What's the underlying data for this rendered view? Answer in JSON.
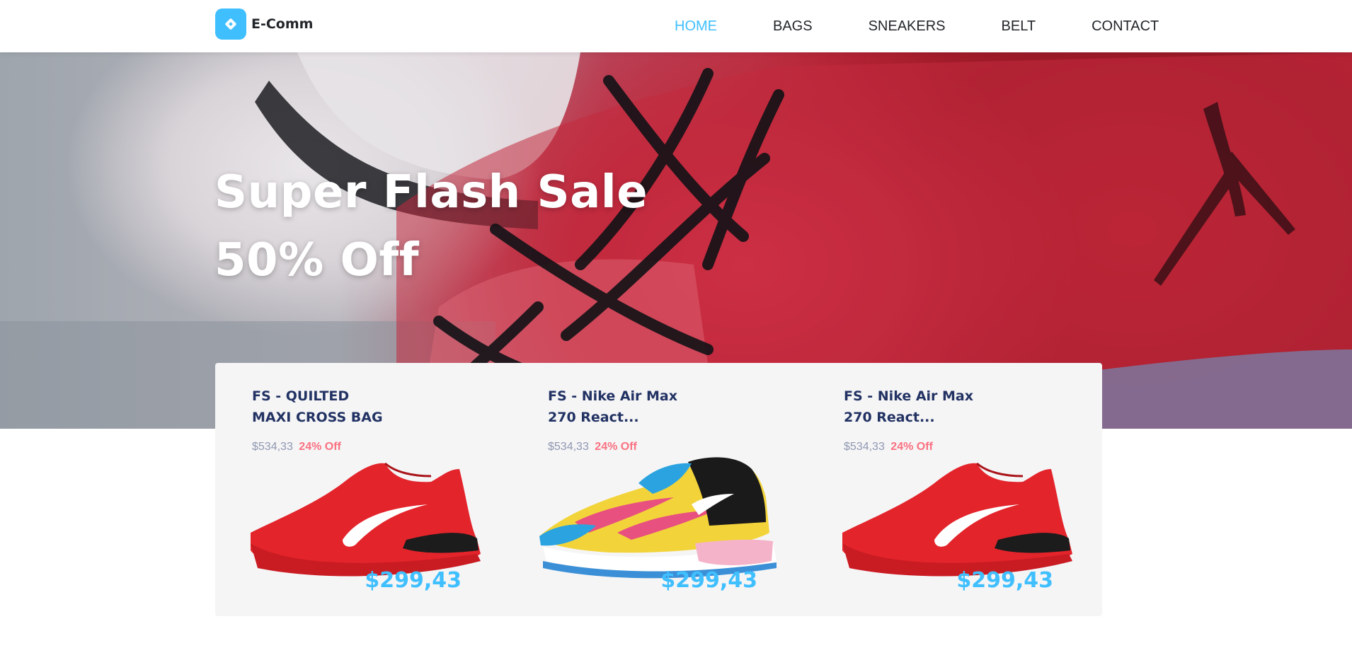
{
  "brand": {
    "name": "E-Comm",
    "logo_icon": "diamond-logo-icon",
    "accent": "#40bfff"
  },
  "nav": {
    "items": [
      {
        "label": "HOME",
        "active": true
      },
      {
        "label": "BAGS",
        "active": false
      },
      {
        "label": "SNEAKERS",
        "active": false
      },
      {
        "label": "BELT",
        "active": false
      },
      {
        "label": "CONTACT",
        "active": false
      }
    ]
  },
  "hero": {
    "title": "Super Flash Sale",
    "subtitle": "50% Off"
  },
  "products": [
    {
      "title_line1": "FS - QUILTED",
      "title_line2": "MAXI CROSS BAG",
      "old_price": "$534,33",
      "discount": "24% Off",
      "price": "$299,43",
      "image": "red-sneaker-image"
    },
    {
      "title_line1": "FS - Nike Air Max",
      "title_line2": "270 React...",
      "old_price": "$534,33",
      "discount": "24% Off",
      "price": "$299,43",
      "image": "multicolor-sneaker-image"
    },
    {
      "title_line1": "FS - Nike Air Max",
      "title_line2": "270 React...",
      "old_price": "$534,33",
      "discount": "24% Off",
      "price": "$299,43",
      "image": "red-sneaker-image"
    }
  ],
  "colors": {
    "title_text": "#223263",
    "old_price": "#9098b1",
    "discount": "#fb7181",
    "price": "#40bfff"
  }
}
